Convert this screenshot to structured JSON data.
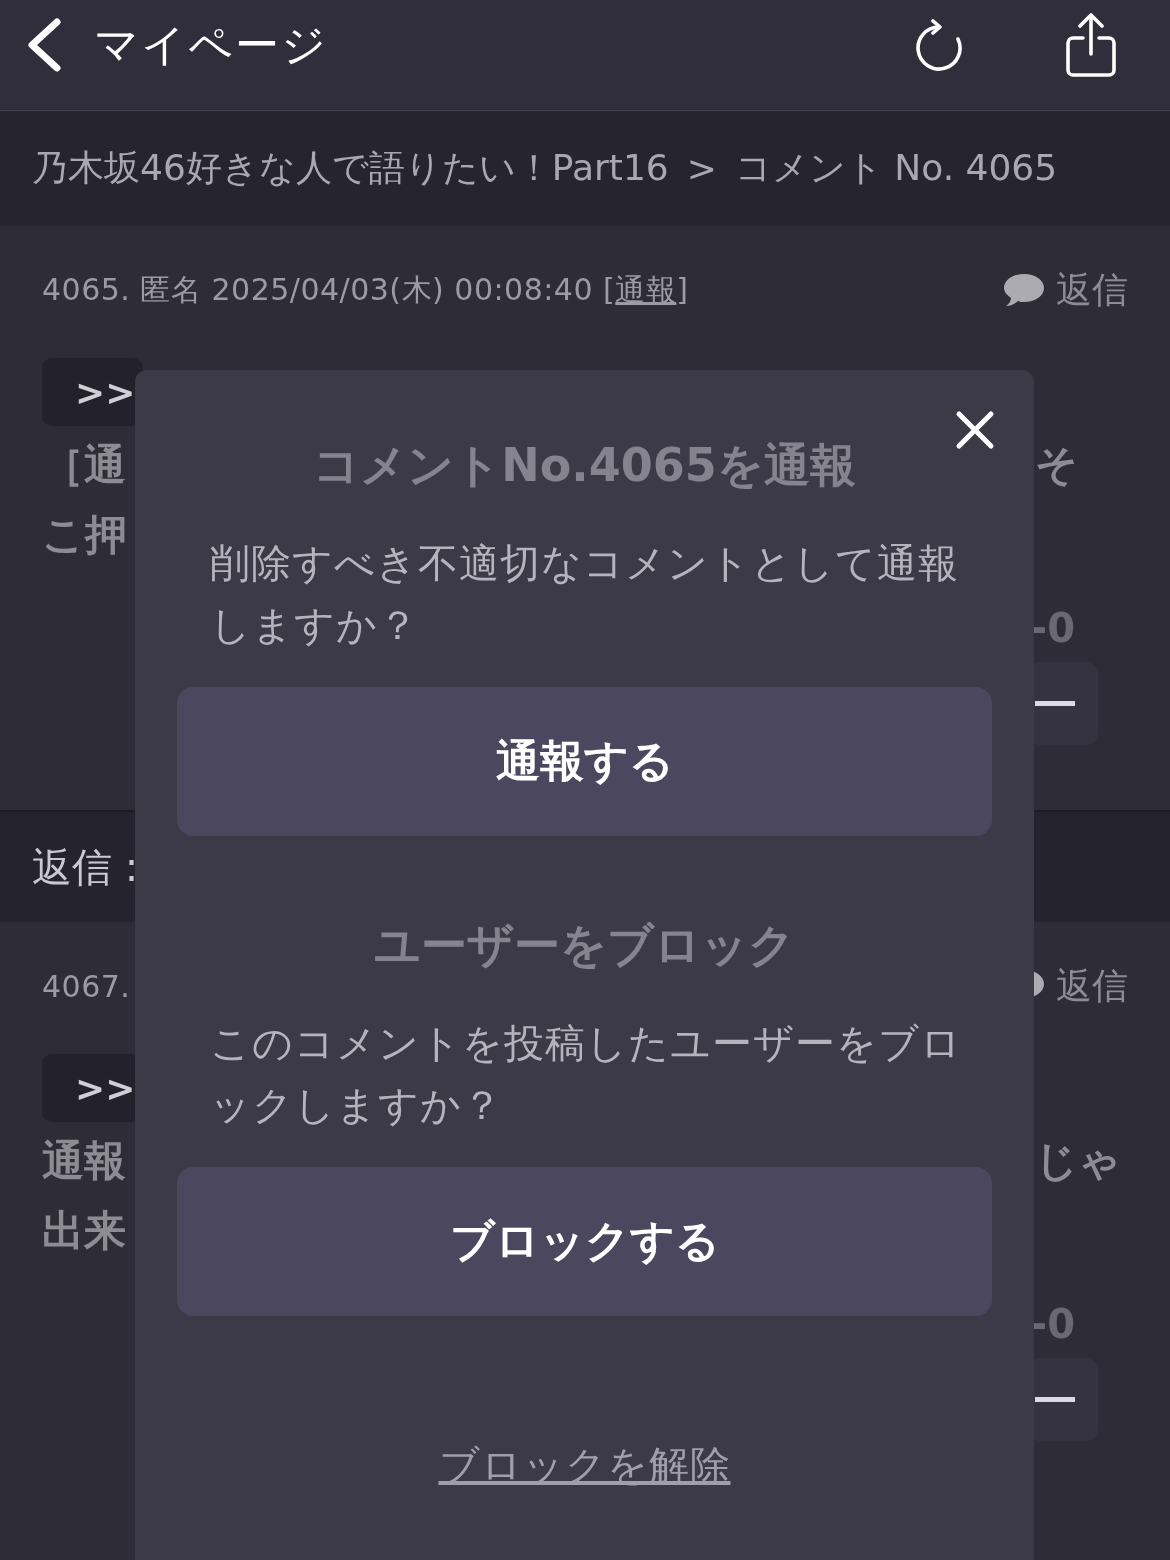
{
  "nav": {
    "back_label": "マイページ"
  },
  "breadcrumb": {
    "parent": "乃木坂46好きな人で語りたい！Part16",
    "separator": ">",
    "current": "コメント No. 4065"
  },
  "sections": [
    {
      "kind": "comment",
      "meta": "4065. 匿名 2025/04/03(木) 00:08:40 [",
      "report_link": "通報",
      "meta_end": "]",
      "reply_label": "返信",
      "quote": ">>",
      "lines": [
        {
          "left": "［通",
          "right": "そ"
        },
        {
          "left": "こ押"
        }
      ],
      "vote_count": "-0"
    },
    {
      "kind": "heading",
      "label": "返信 :"
    },
    {
      "kind": "comment",
      "meta": "4067.",
      "reply_label": "返信",
      "quote": ">>",
      "lines": [
        {
          "left": "通報",
          "right": "じゃ"
        },
        {
          "left": "出来"
        }
      ],
      "vote_count": "-0"
    }
  ],
  "dialog": {
    "sections": [
      {
        "title": "コメントNo.4065を通報",
        "message": "削除すべき不適切なコメントとして通報しますか？",
        "button": "通報する"
      },
      {
        "title": "ユーザーをブロック",
        "message": "このコメントを投稿したユーザーをブロックしますか？",
        "button": "ブロックする"
      }
    ],
    "unblock_link": "ブロックを解除"
  }
}
